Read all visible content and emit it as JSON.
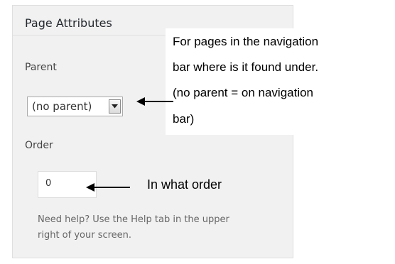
{
  "panel": {
    "title": "Page Attributes",
    "parent_label": "Parent",
    "parent_select_value": "(no parent)",
    "order_label": "Order",
    "order_value": "0",
    "help_line1": "Need help? Use the Help tab in the upper",
    "help_line2": "right of your screen."
  },
  "annotations": {
    "parent_line1": "For pages in the navigation",
    "parent_line2": "bar where is it found under.",
    "parent_line3": "(no parent = on navigation",
    "parent_line4": "bar)",
    "order_note": "In what order"
  },
  "icons": {
    "select_arrow": "chevron-down-icon",
    "pointer_arrow": "arrow-left-icon"
  },
  "colors": {
    "panel_bg": "#f1f1f1",
    "panel_border": "#dfdfdf",
    "text_dark": "#23282d",
    "help_text": "#666666"
  }
}
